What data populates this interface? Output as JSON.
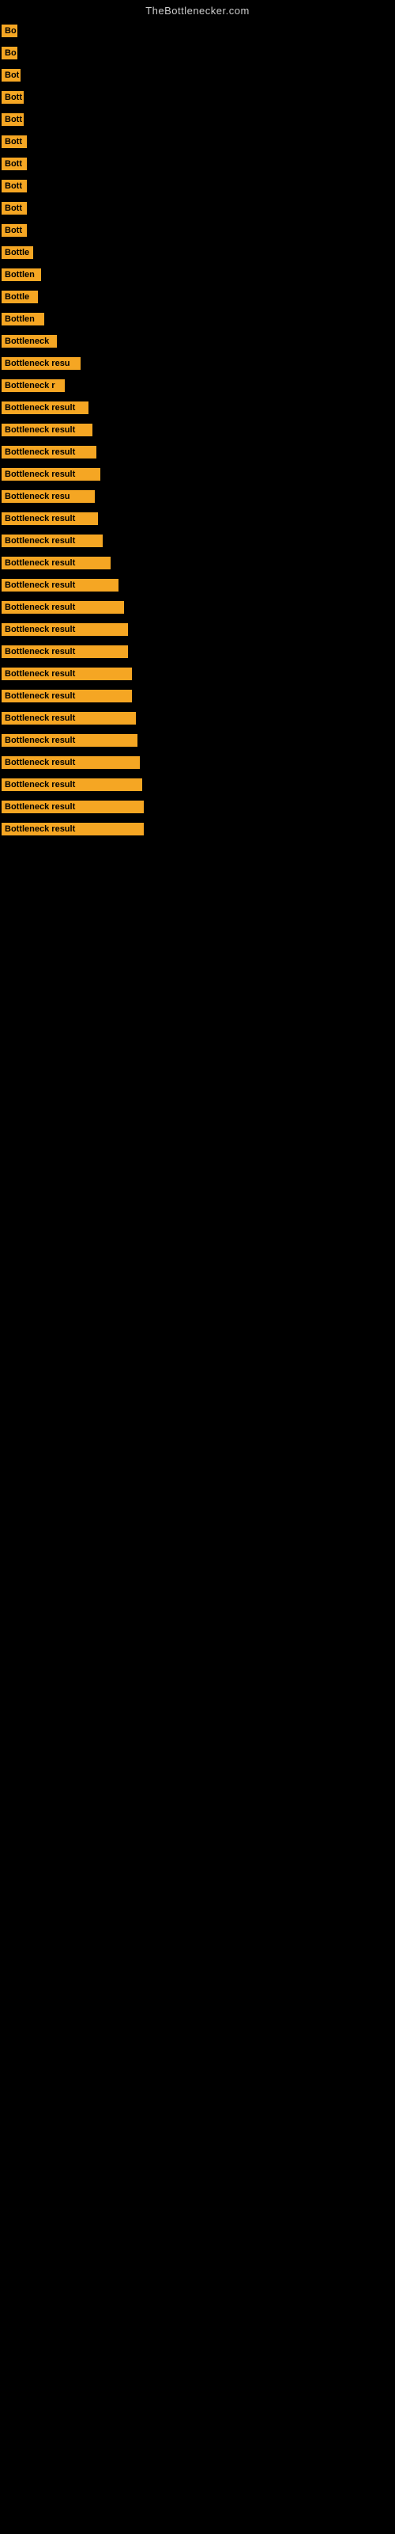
{
  "site": {
    "title": "TheBottlenecker.com"
  },
  "bars": [
    {
      "label": "Bo",
      "width": 20
    },
    {
      "label": "Bo",
      "width": 20
    },
    {
      "label": "Bot",
      "width": 24
    },
    {
      "label": "Bott",
      "width": 28
    },
    {
      "label": "Bott",
      "width": 28
    },
    {
      "label": "Bott",
      "width": 32
    },
    {
      "label": "Bott",
      "width": 32
    },
    {
      "label": "Bott",
      "width": 32
    },
    {
      "label": "Bott",
      "width": 32
    },
    {
      "label": "Bott",
      "width": 32
    },
    {
      "label": "Bottle",
      "width": 40
    },
    {
      "label": "Bottlen",
      "width": 50
    },
    {
      "label": "Bottle",
      "width": 46
    },
    {
      "label": "Bottlen",
      "width": 54
    },
    {
      "label": "Bottleneck",
      "width": 70
    },
    {
      "label": "Bottleneck resu",
      "width": 100
    },
    {
      "label": "Bottleneck r",
      "width": 80
    },
    {
      "label": "Bottleneck result",
      "width": 110
    },
    {
      "label": "Bottleneck result",
      "width": 115
    },
    {
      "label": "Bottleneck result",
      "width": 120
    },
    {
      "label": "Bottleneck result",
      "width": 125
    },
    {
      "label": "Bottleneck resu",
      "width": 118
    },
    {
      "label": "Bottleneck result",
      "width": 122
    },
    {
      "label": "Bottleneck result",
      "width": 128
    },
    {
      "label": "Bottleneck result",
      "width": 138
    },
    {
      "label": "Bottleneck result",
      "width": 148
    },
    {
      "label": "Bottleneck result",
      "width": 155
    },
    {
      "label": "Bottleneck result",
      "width": 160
    },
    {
      "label": "Bottleneck result",
      "width": 160
    },
    {
      "label": "Bottleneck result",
      "width": 165
    },
    {
      "label": "Bottleneck result",
      "width": 165
    },
    {
      "label": "Bottleneck result",
      "width": 170
    },
    {
      "label": "Bottleneck result",
      "width": 172
    },
    {
      "label": "Bottleneck result",
      "width": 175
    },
    {
      "label": "Bottleneck result",
      "width": 178
    },
    {
      "label": "Bottleneck result",
      "width": 180
    },
    {
      "label": "Bottleneck result",
      "width": 180
    }
  ]
}
